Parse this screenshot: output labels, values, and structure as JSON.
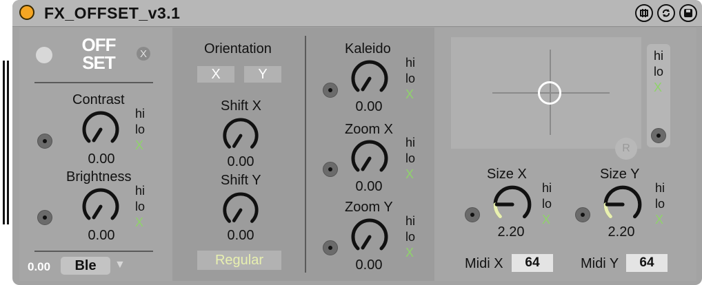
{
  "device": {
    "title": "FX_OFFSET_v3.1",
    "logo_text": "OFF SET",
    "x_label": "X"
  },
  "left": {
    "contrast": {
      "label": "Contrast",
      "value": "0.00",
      "hi": "hi",
      "lo": "lo",
      "x": "X"
    },
    "brightness": {
      "label": "Brightness",
      "value": "0.00",
      "hi": "hi",
      "lo": "lo",
      "x": "X"
    },
    "footer_value": "0.00",
    "blend_label": "Ble",
    "dropdown_arrow": "▼"
  },
  "middle": {
    "orientation_label": "Orientation",
    "orient_x": "X",
    "orient_y": "Y",
    "shift_x": {
      "label": "Shift X",
      "value": "0.00"
    },
    "shift_y": {
      "label": "Shift Y",
      "value": "0.00"
    },
    "mode_label": "Regular",
    "kaleido": {
      "label": "Kaleido",
      "value": "0.00",
      "hi": "hi",
      "lo": "lo",
      "x": "X"
    },
    "zoom_x": {
      "label": "Zoom X",
      "value": "0.00",
      "hi": "hi",
      "lo": "lo",
      "x": "X"
    },
    "zoom_y": {
      "label": "Zoom Y",
      "value": "0.00",
      "hi": "hi",
      "lo": "lo",
      "x": "X"
    }
  },
  "right": {
    "xy_hi": "hi",
    "xy_lo": "lo",
    "xy_x": "X",
    "size_x": {
      "label": "Size X",
      "value": "2.20",
      "hi": "hi",
      "lo": "lo",
      "x": "X",
      "level": 0.55
    },
    "size_y": {
      "label": "Size Y",
      "value": "2.20",
      "hi": "hi",
      "lo": "lo",
      "x": "X",
      "level": 0.55
    },
    "midi_x_label": "Midi X",
    "midi_x_value": "64",
    "midi_y_label": "Midi Y",
    "midi_y_value": "64"
  },
  "colors": {
    "title_dot": "#f5a623",
    "accent_green": "#8fd36a",
    "knob_arc": "#e8f0b0"
  }
}
